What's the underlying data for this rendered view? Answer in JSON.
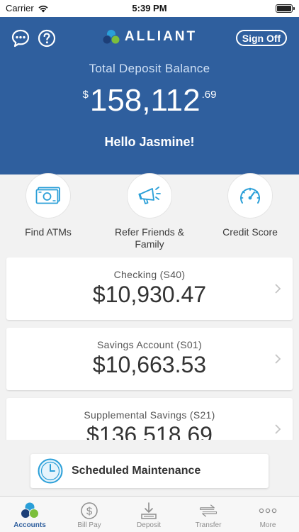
{
  "status_bar": {
    "carrier": "Carrier",
    "time": "5:39 PM"
  },
  "header": {
    "logo_text": "ALLIANT",
    "sign_off_label": "Sign Off",
    "balance_label": "Total Deposit Balance",
    "balance_currency": "$",
    "balance_main": "158,112",
    "balance_cents": ".69",
    "greeting": "Hello Jasmine!",
    "icons": [
      "chat-icon",
      "help-icon"
    ]
  },
  "quick_actions": [
    {
      "label": "Find ATMs",
      "icon": "atm-cash-icon"
    },
    {
      "label": "Refer Friends & Family",
      "icon": "megaphone-icon"
    },
    {
      "label": "Credit Score",
      "icon": "speedometer-icon"
    }
  ],
  "accounts": [
    {
      "name": "Checking (S40)",
      "balance": "$10,930.47"
    },
    {
      "name": "Savings Account (S01)",
      "balance": "$10,663.53"
    },
    {
      "name": "Supplemental Savings (S21)",
      "balance": "$136,518.69"
    }
  ],
  "maintenance": {
    "label": "Scheduled Maintenance",
    "icon": "clock-icon"
  },
  "tabs": [
    {
      "label": "Accounts",
      "icon": "alliant-logo-icon",
      "active": true
    },
    {
      "label": "Bill Pay",
      "icon": "dollar-circle-icon",
      "active": false
    },
    {
      "label": "Deposit",
      "icon": "deposit-icon",
      "active": false
    },
    {
      "label": "Transfer",
      "icon": "transfer-arrows-icon",
      "active": false
    },
    {
      "label": "More",
      "icon": "more-dots-icon",
      "active": false
    }
  ],
  "colors": {
    "brand_blue": "#2f5f9e",
    "accent_cyan": "#2a9fd8",
    "accent_green": "#7cbf3c"
  }
}
